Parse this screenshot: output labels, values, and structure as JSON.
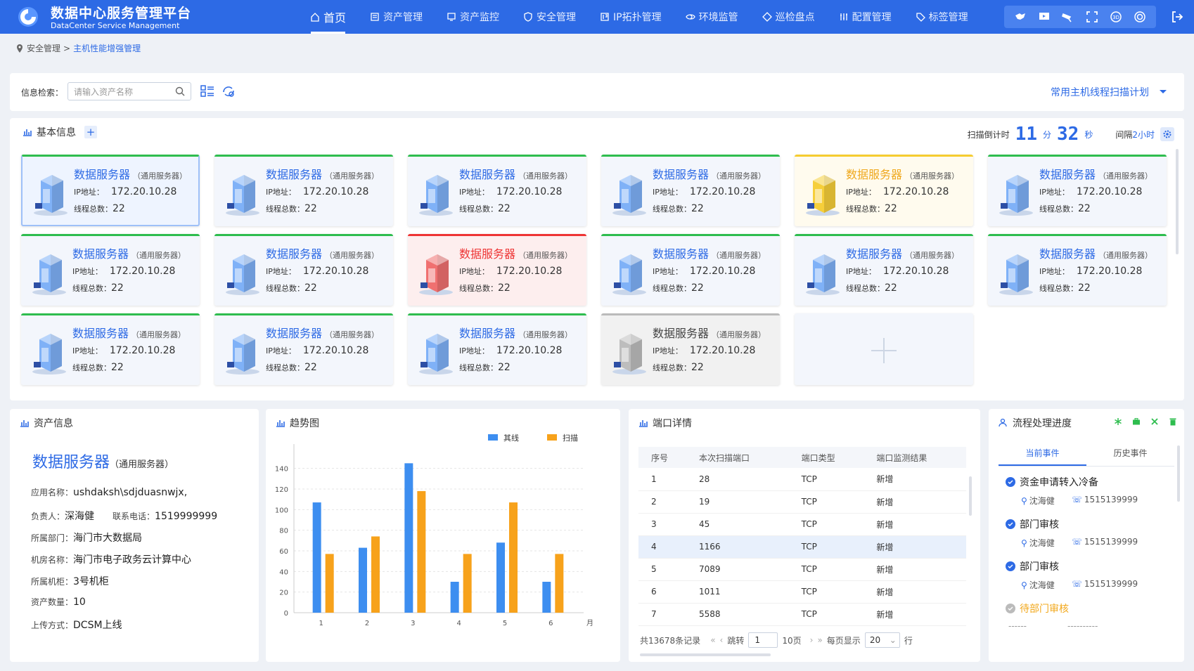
{
  "app": {
    "title_cn": "数据中心服务管理平台",
    "title_en": "DataCenter Service Management"
  },
  "nav": [
    {
      "label": "首页",
      "icon": "home-icon"
    },
    {
      "label": "资产管理",
      "icon": "asset-icon"
    },
    {
      "label": "资产监控",
      "icon": "monitor-icon"
    },
    {
      "label": "安全管理",
      "icon": "shield-icon"
    },
    {
      "label": "IP拓扑管理",
      "icon": "ip-icon"
    },
    {
      "label": "环境监管",
      "icon": "eye-icon"
    },
    {
      "label": "巡检盘点",
      "icon": "inspect-icon"
    },
    {
      "label": "配置管理",
      "icon": "config-icon"
    },
    {
      "label": "标签管理",
      "icon": "tag-icon"
    }
  ],
  "toolbar_icons": [
    "map-icon",
    "screen-icon",
    "camera-icon",
    "fullscreen-icon",
    "3d-icon",
    "target-icon"
  ],
  "breadcrumb": {
    "parent": "安全管理",
    "sep": ">",
    "current": "主机性能增强管理"
  },
  "search": {
    "label": "信息检索：",
    "placeholder": "请输入资产名称",
    "plan": "常用主机线程扫描计划"
  },
  "basic": {
    "title": "基本信息",
    "scan_label": "扫描倒计时",
    "minutes": "11",
    "min_unit": "分",
    "seconds": "32",
    "sec_unit": "秒",
    "interval_label": "间隔",
    "interval_value": "2小时"
  },
  "card_labels": {
    "ip": "IP地址：",
    "threads": "线程总数："
  },
  "cards": [
    {
      "name": "数据服务器",
      "type": "（通用服务器）",
      "ip": "172.20.10.28",
      "threads": "22",
      "status": "normal",
      "selected": true
    },
    {
      "name": "数据服务器",
      "type": "（通用服务器）",
      "ip": "172.20.10.28",
      "threads": "22",
      "status": "normal"
    },
    {
      "name": "数据服务器",
      "type": "（通用服务器）",
      "ip": "172.20.10.28",
      "threads": "22",
      "status": "normal"
    },
    {
      "name": "数据服务器",
      "type": "（通用服务器）",
      "ip": "172.20.10.28",
      "threads": "22",
      "status": "normal"
    },
    {
      "name": "数据服务器",
      "type": "（通用服务器）",
      "ip": "172.20.10.28",
      "threads": "22",
      "status": "warn"
    },
    {
      "name": "数据服务器",
      "type": "（通用服务器）",
      "ip": "172.20.10.28",
      "threads": "22",
      "status": "normal"
    },
    {
      "name": "数据服务器",
      "type": "（通用服务器）",
      "ip": "172.20.10.28",
      "threads": "22",
      "status": "normal"
    },
    {
      "name": "数据服务器",
      "type": "（通用服务器）",
      "ip": "172.20.10.28",
      "threads": "22",
      "status": "normal"
    },
    {
      "name": "数据服务器",
      "type": "（通用服务器）",
      "ip": "172.20.10.28",
      "threads": "22",
      "status": "err"
    },
    {
      "name": "数据服务器",
      "type": "（通用服务器）",
      "ip": "172.20.10.28",
      "threads": "22",
      "status": "normal"
    },
    {
      "name": "数据服务器",
      "type": "（通用服务器）",
      "ip": "172.20.10.28",
      "threads": "22",
      "status": "normal"
    },
    {
      "name": "数据服务器",
      "type": "（通用服务器）",
      "ip": "172.20.10.28",
      "threads": "22",
      "status": "normal"
    },
    {
      "name": "数据服务器",
      "type": "（通用服务器）",
      "ip": "172.20.10.28",
      "threads": "22",
      "status": "normal"
    },
    {
      "name": "数据服务器",
      "type": "（通用服务器）",
      "ip": "172.20.10.28",
      "threads": "22",
      "status": "normal"
    },
    {
      "name": "数据服务器",
      "type": "（通用服务器）",
      "ip": "172.20.10.28",
      "threads": "22",
      "status": "normal"
    },
    {
      "name": "数据服务器",
      "type": "（通用服务器）",
      "ip": "172.20.10.28",
      "threads": "22",
      "status": "off"
    }
  ],
  "asset": {
    "title": "资产信息",
    "name": "数据服务器",
    "type": "（通用服务器）",
    "rows": [
      {
        "label": "应用名称：",
        "value": "ushdaksh\\sdjduasnwjx,"
      },
      {
        "label": "负责人：",
        "value": "深海健"
      },
      {
        "label": "所属部门：",
        "value": "海门市大数据局"
      },
      {
        "label": "机房名称：",
        "value": "海门市电子政务云计算中心"
      },
      {
        "label": "所属机柜：",
        "value": "3号机柜"
      },
      {
        "label": "资产数量：",
        "value": "10"
      },
      {
        "label": "上传方式：",
        "value": "DCSM上线"
      }
    ],
    "phone_label": "联系电话：",
    "phone": "1519999999"
  },
  "trend": {
    "title": "趋势图"
  },
  "chart_data": {
    "type": "bar",
    "categories": [
      "1",
      "2",
      "3",
      "4",
      "5",
      "6"
    ],
    "xlabel": "月",
    "ylim": [
      0,
      150
    ],
    "yticks": [
      0,
      20,
      40,
      60,
      80,
      100,
      120,
      140
    ],
    "legend": "top-right",
    "grid": true,
    "series": [
      {
        "name": "其线",
        "color": "#3d8ef0",
        "values": [
          107,
          63,
          145,
          30,
          68,
          30
        ]
      },
      {
        "name": "扫描",
        "color": "#f7a21b",
        "values": [
          57,
          74,
          118,
          57,
          107,
          57
        ]
      }
    ]
  },
  "ports": {
    "title": "端口详情",
    "headers": [
      "序号",
      "本次扫描端口",
      "端口类型",
      "端口监测结果"
    ],
    "rows": [
      [
        "1",
        "28",
        "TCP",
        "新增"
      ],
      [
        "2",
        "19",
        "TCP",
        "新增"
      ],
      [
        "3",
        "45",
        "TCP",
        "新增"
      ],
      [
        "4",
        "1166",
        "TCP",
        "新增"
      ],
      [
        "5",
        "7089",
        "TCP",
        "新增"
      ],
      [
        "6",
        "1011",
        "TCP",
        "新增"
      ],
      [
        "7",
        "5588",
        "TCP",
        "新增"
      ]
    ],
    "highlight_row": 3,
    "pager": {
      "total": "共13678条记录",
      "jump": "跳转",
      "page": "1",
      "pages": "10页",
      "per": "每页显示",
      "size": "20",
      "unit": "行"
    }
  },
  "flow": {
    "title": "流程处理进度",
    "tabs": [
      "当前事件",
      "历史事件"
    ],
    "items": [
      {
        "title": "资金申请转入冷备",
        "person": "沈海健",
        "phone": "1515139999",
        "done": true
      },
      {
        "title": "部门审核",
        "person": "沈海健",
        "phone": "1515139999",
        "done": true
      },
      {
        "title": "部门审核",
        "person": "沈海健",
        "phone": "1515139999",
        "done": true
      },
      {
        "title": "待部门审核",
        "person": "------",
        "phone": "----------",
        "done": false
      }
    ]
  },
  "colors": {
    "primary": "#2d6ae5",
    "ok": "#2ebd4e",
    "warn": "#f6cc2f",
    "err": "#ee3434",
    "off": "#bbbbbb"
  }
}
